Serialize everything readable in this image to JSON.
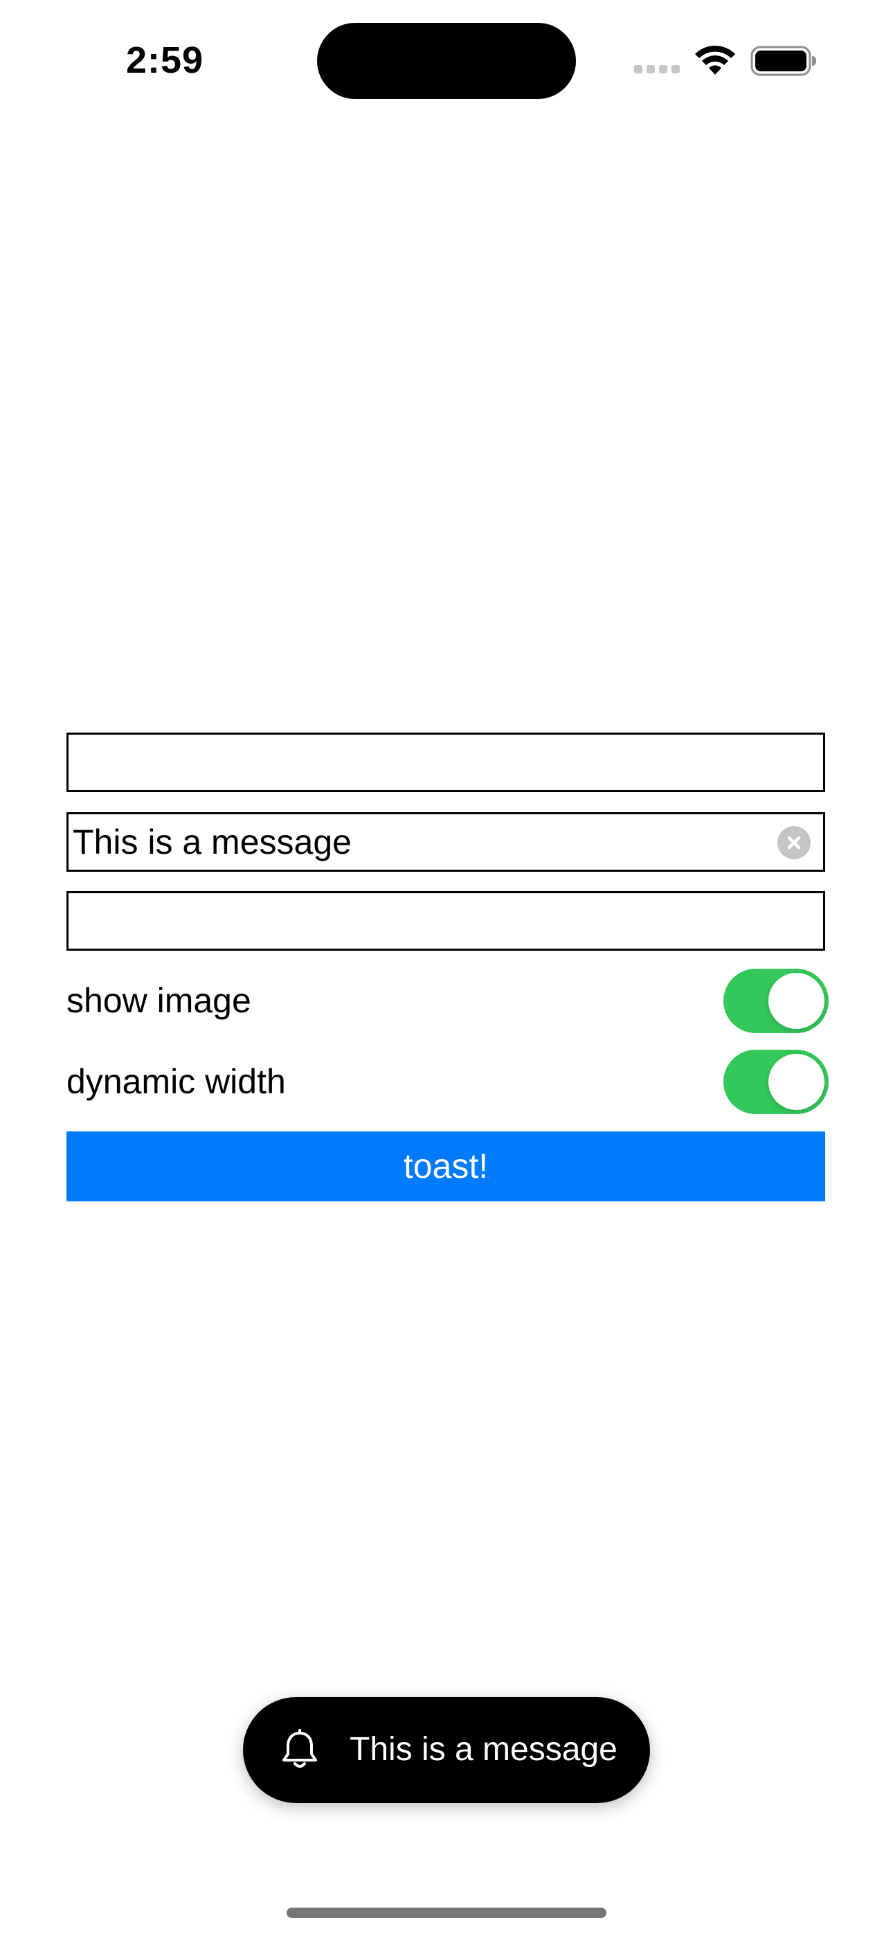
{
  "status_bar": {
    "time": "2:59"
  },
  "form": {
    "field_1": {
      "value": "",
      "placeholder": ""
    },
    "field_2": {
      "value": "This is a message",
      "placeholder": ""
    },
    "field_3": {
      "value": "",
      "placeholder": ""
    },
    "show_image": {
      "label": "show image",
      "on": true
    },
    "dynamic_width": {
      "label": "dynamic width",
      "on": true
    },
    "toast_button_label": "toast!"
  },
  "toast": {
    "icon": "bell-icon",
    "message": "This is a message"
  },
  "colors": {
    "switch_on": "#34c759",
    "button_blue": "#007aff",
    "toast_background": "#000000"
  }
}
